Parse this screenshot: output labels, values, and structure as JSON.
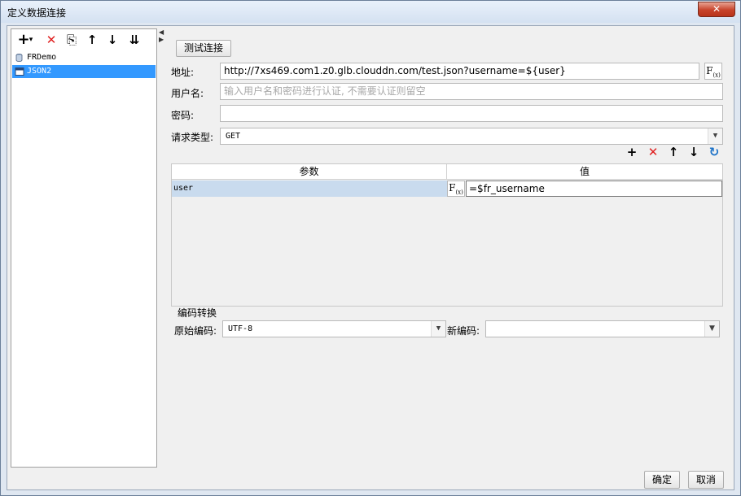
{
  "window": {
    "title": "定义数据连接",
    "close_glyph": "✕"
  },
  "left_toolbar": {
    "add": "+",
    "add_dropdown": "▾",
    "delete": "✕",
    "copy": "⎘",
    "move_up": "↑",
    "move_down": "↓",
    "sort": "⇊"
  },
  "tree": {
    "items": [
      {
        "label": "FRDemo",
        "icon": "database-icon",
        "selected": false
      },
      {
        "label": "JSON2",
        "icon": "json-icon",
        "selected": true
      }
    ]
  },
  "form": {
    "test_button": "测试连接",
    "address_label": "地址:",
    "address_value": "http://7xs469.com1.z0.glb.clouddn.com/test.json?username=${user}",
    "username_label": "用户名:",
    "username_placeholder": "输入用户名和密码进行认证, 不需要认证则留空",
    "password_label": "密码:",
    "password_value": "",
    "request_type_label": "请求类型:",
    "request_type_value": "GET"
  },
  "param_toolbar": {
    "add": "+",
    "delete": "✕",
    "up": "↑",
    "down": "↓",
    "refresh": "↻"
  },
  "params_table": {
    "headers": [
      "参数",
      "值"
    ],
    "rows": [
      {
        "param": "user",
        "value": "=$fr_username"
      }
    ]
  },
  "encoding": {
    "group_label": "编码转换",
    "original_label": "原始编码:",
    "original_value": "UTF-8",
    "new_label": "新编码:",
    "new_value": ""
  },
  "footer": {
    "ok": "确定",
    "cancel": "取消"
  },
  "colors": {
    "selection": "#3399ff",
    "row_highlight": "#c9dbee",
    "delete_red": "#e02020",
    "refresh_blue": "#1e73c8"
  }
}
